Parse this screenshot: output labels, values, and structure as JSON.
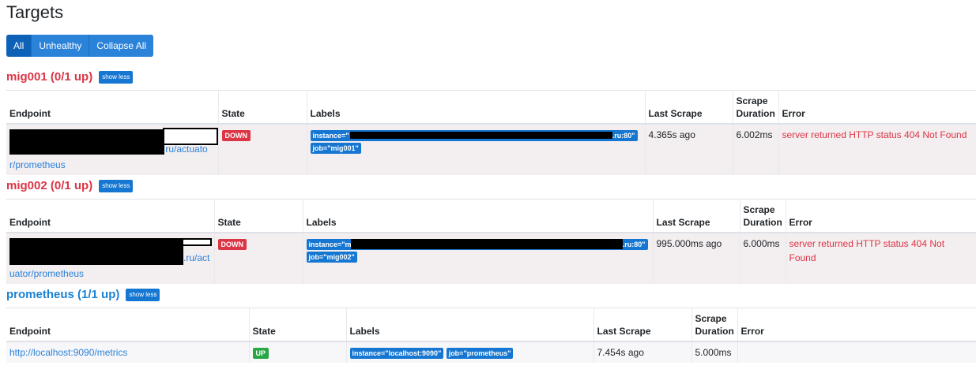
{
  "page": {
    "title": "Targets"
  },
  "filters": {
    "all": "All",
    "unhealthy": "Unhealthy",
    "collapse_all": "Collapse All"
  },
  "columns": {
    "endpoint": "Endpoint",
    "state": "State",
    "labels": "Labels",
    "last_scrape": "Last Scrape",
    "scrape_duration": "Scrape Duration",
    "error": "Error"
  },
  "show_less": "show less",
  "pools": [
    {
      "title": "mig001 (0/1 up)",
      "endpoint_tail_1": ".ru/actuato",
      "endpoint_tail_2": "r/prometheus",
      "state": "DOWN",
      "label_instance_prefix": "instance=\"",
      "label_instance_suffix": ".ru:80\"",
      "label_job": "job=\"mig001\"",
      "last_scrape": "4.365s ago",
      "scrape_duration": "6.002ms",
      "error": "server returned HTTP status 404 Not Found"
    },
    {
      "title": "mig002 (0/1 up)",
      "endpoint_tail_1": ".ru/act",
      "endpoint_tail_2": "uator/prometheus",
      "state": "DOWN",
      "label_instance_prefix": "instance=\"m",
      "label_instance_suffix": ".ru:80\"",
      "label_job": "job=\"mig002\"",
      "last_scrape": "995.000ms ago",
      "scrape_duration": "6.000ms",
      "error": "server returned HTTP status 404 Not Found"
    },
    {
      "title": "prometheus (1/1 up)",
      "endpoint": "http://localhost:9090/metrics",
      "state": "UP",
      "label_instance": "instance=\"localhost:9090\"",
      "label_job": "job=\"prometheus\"",
      "last_scrape": "7.454s ago",
      "scrape_duration": "5.000ms",
      "error": ""
    }
  ],
  "colors": {
    "accent": "#1677d2",
    "down": "#dc3545",
    "up": "#28a745"
  }
}
